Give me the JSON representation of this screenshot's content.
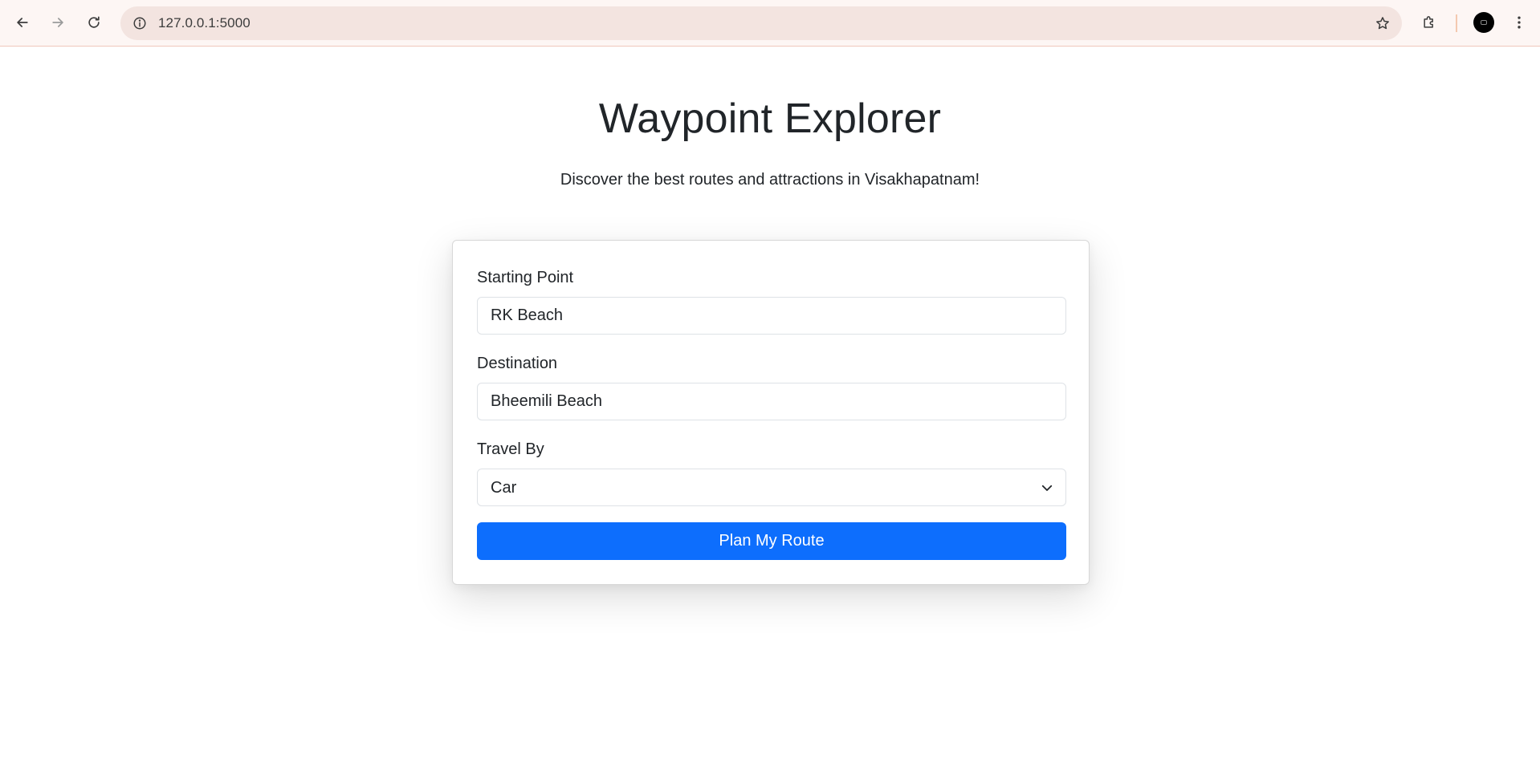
{
  "browser": {
    "url": "127.0.0.1:5000",
    "icons": {
      "back": "arrow-left-icon",
      "forward": "arrow-right-icon",
      "reload": "reload-icon",
      "site_info": "info-icon",
      "bookmark": "star-icon",
      "extensions": "puzzle-icon",
      "profile": "avatar",
      "menu": "kebab-menu-icon"
    },
    "colors": {
      "toolbar_bg": "#fdf6f4",
      "omnibox_bg": "#f3e4e0"
    }
  },
  "header": {
    "title": "Waypoint Explorer",
    "subtitle": "Discover the best routes and attractions in Visakhapatnam!"
  },
  "form": {
    "start": {
      "label": "Starting Point",
      "value": "RK Beach"
    },
    "destination": {
      "label": "Destination",
      "value": "Bheemili Beach"
    },
    "travel": {
      "label": "Travel By",
      "selected": "Car"
    },
    "submit_label": "Plan My Route",
    "accent_color": "#0d6efd"
  }
}
